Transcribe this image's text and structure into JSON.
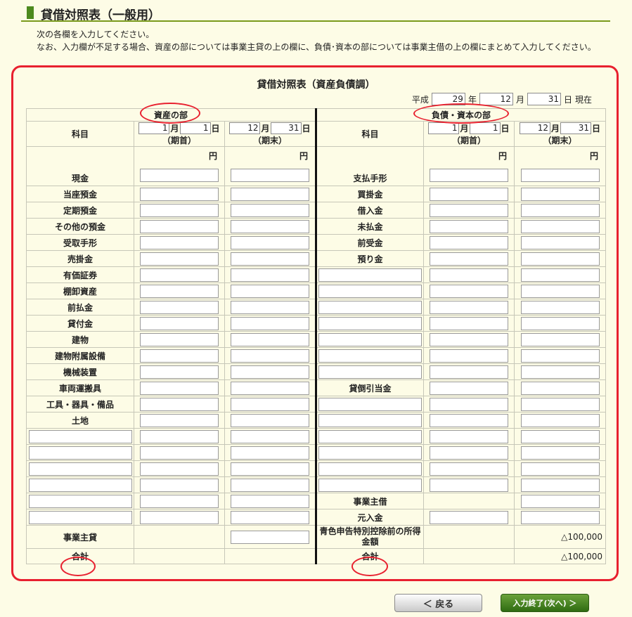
{
  "page_title": "貸借対照表（一般用）",
  "instructions": [
    "次の各欄を入力してください。",
    "なお、入力欄が不足する場合、資産の部については事業主貸の上の欄に、負債･資本の部については事業主借の上の欄にまとめて入力してください。"
  ],
  "sheet_title": "貸借対照表（資産負債調）",
  "as_of": {
    "era": "平成",
    "year": "29",
    "year_label": "年",
    "month": "12",
    "month_label": "月",
    "day": "31",
    "day_label": "日",
    "suffix": "現在"
  },
  "headers": {
    "assets": "資産の部",
    "liabilities": "負債・資本の部",
    "subject": "科目",
    "start_label": "（期首）",
    "end_label": "（期末）",
    "unit": "円",
    "month_label": "月",
    "day_label": "日",
    "start_month": "1",
    "start_day": "1",
    "end_month": "12",
    "end_day": "31"
  },
  "asset_items": [
    "現金",
    "当座預金",
    "定期預金",
    "その他の預金",
    "受取手形",
    "売掛金",
    "有価証券",
    "棚卸資産",
    "前払金",
    "貸付金",
    "建物",
    "建物附属設備",
    "機械装置",
    "車両運搬具",
    "工具・器具・備品",
    "土地"
  ],
  "liability_items": [
    "支払手形",
    "買掛金",
    "借入金",
    "未払金",
    "前受金",
    "預り金",
    "",
    "",
    "",
    "",
    "",
    "",
    "",
    "貸倒引当金",
    "",
    ""
  ],
  "owner_draw": "事業主貸",
  "owner_contribution": "事業主借",
  "capital": "元入金",
  "pre_deduction_income": "青色申告特別控除前の所得金額",
  "pre_deduction_value": "△100,000",
  "total_label": "合計",
  "total_value": "△100,000",
  "buttons": {
    "back": "＜ 戻る",
    "next": "入力終了(次へ) ＞"
  },
  "colors": {
    "accent_green": "#4d8a1e",
    "highlight_red": "#e8202f",
    "page_bg": "#fdfce6"
  }
}
